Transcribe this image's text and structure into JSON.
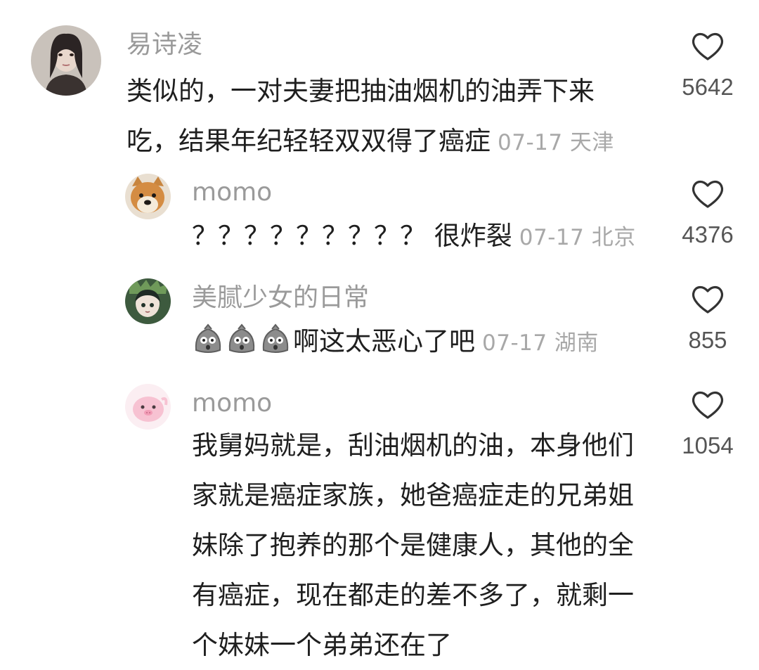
{
  "comments": [
    {
      "author": "易诗凌",
      "text": "类似的，一对夫妻把抽油烟机的油弄下来吃，结果年纪轻轻双双得了癌症",
      "meta": "07-17 天津",
      "likes": "5642",
      "avatar_icon": "avatar-photo-woman"
    },
    {
      "author": "momo",
      "text": "？？？？？？？？？ 很炸裂",
      "meta": "07-17 北京",
      "likes": "4376",
      "avatar_icon": "avatar-dog"
    },
    {
      "author": "美腻少女的日常",
      "text": "啊这太恶心了吧",
      "meta": "07-17 湖南",
      "likes": "855",
      "avatar_icon": "avatar-anime-girl",
      "emojis": [
        "shocked-emoji",
        "shocked-emoji",
        "shocked-emoji"
      ]
    },
    {
      "author": "momo",
      "text": "我舅妈就是，刮油烟机的油，本身他们家就是癌症家族，她爸癌症走的兄弟姐妹除了抱养的那个是健康人，其他的全有癌症，现在都走的差不多了，就剩一个妹妹一个弟弟还在了",
      "meta": "",
      "likes": "1054",
      "avatar_icon": "avatar-pink-pig"
    }
  ],
  "colors": {
    "name": "#9a9a9a",
    "text": "#1f1f1f",
    "meta": "#a8a8a8",
    "count": "#555555",
    "heart_stroke": "#333333"
  }
}
